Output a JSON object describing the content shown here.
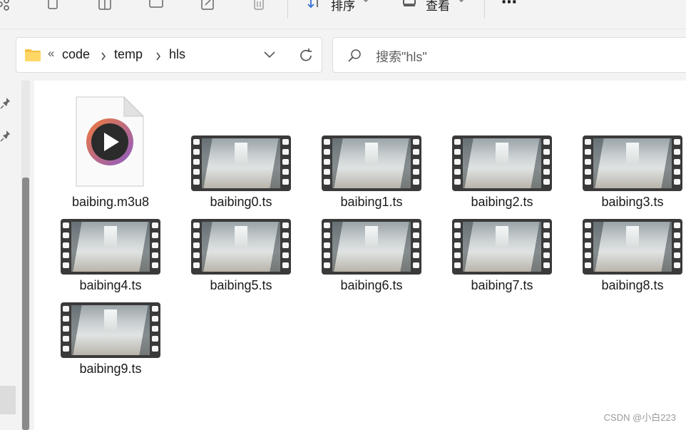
{
  "toolbar": {
    "sort_label": "排序",
    "view_label": "查看",
    "more_label": "⋯"
  },
  "address": {
    "overflow": "«",
    "crumbs": [
      "code",
      "temp",
      "hls"
    ]
  },
  "search": {
    "placeholder": "搜索\"hls\""
  },
  "files": [
    {
      "name": "baibing.m3u8",
      "type": "playlist"
    },
    {
      "name": "baibing0.ts",
      "type": "video"
    },
    {
      "name": "baibing1.ts",
      "type": "video"
    },
    {
      "name": "baibing2.ts",
      "type": "video"
    },
    {
      "name": "baibing3.ts",
      "type": "video"
    },
    {
      "name": "baibing4.ts",
      "type": "video"
    },
    {
      "name": "baibing5.ts",
      "type": "video"
    },
    {
      "name": "baibing6.ts",
      "type": "video"
    },
    {
      "name": "baibing7.ts",
      "type": "video"
    },
    {
      "name": "baibing8.ts",
      "type": "video"
    },
    {
      "name": "baibing9.ts",
      "type": "video"
    }
  ],
  "watermark": "CSDN @小白223",
  "colors": {
    "folder": "#f6c244",
    "play_gradient_start": "#f07a3a",
    "play_gradient_end": "#8b5cc7"
  }
}
